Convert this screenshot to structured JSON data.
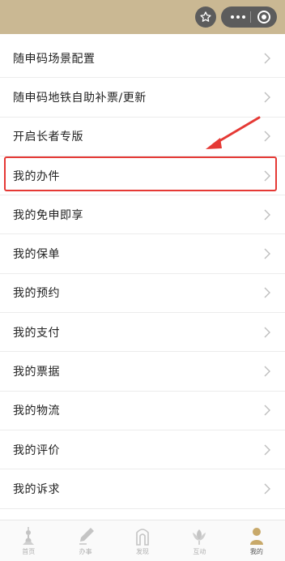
{
  "header": {
    "favorite_icon": "star-icon",
    "more_icon": "more-dots-icon",
    "close_icon": "target-circle-icon"
  },
  "menu": {
    "items": [
      {
        "label": "随申码场景配置"
      },
      {
        "label": "随申码地铁自助补票/更新"
      },
      {
        "label": "开启长者专版"
      },
      {
        "label": "我的办件"
      },
      {
        "label": "我的免申即享"
      },
      {
        "label": "我的保单"
      },
      {
        "label": "我的预约"
      },
      {
        "label": "我的支付"
      },
      {
        "label": "我的票据"
      },
      {
        "label": "我的物流"
      },
      {
        "label": "我的评价"
      },
      {
        "label": "我的诉求"
      }
    ]
  },
  "annotation": {
    "highlight_color": "#e53935"
  },
  "tabbar": {
    "tabs": [
      {
        "label": "首页",
        "icon": "tower-icon"
      },
      {
        "label": "办事",
        "icon": "pen-icon"
      },
      {
        "label": "发现",
        "icon": "arch-icon"
      },
      {
        "label": "互动",
        "icon": "flower-icon"
      },
      {
        "label": "我的",
        "icon": "person-icon"
      }
    ]
  },
  "colors": {
    "header_bg": "#cab893",
    "active_tab": "#c8a96a"
  }
}
